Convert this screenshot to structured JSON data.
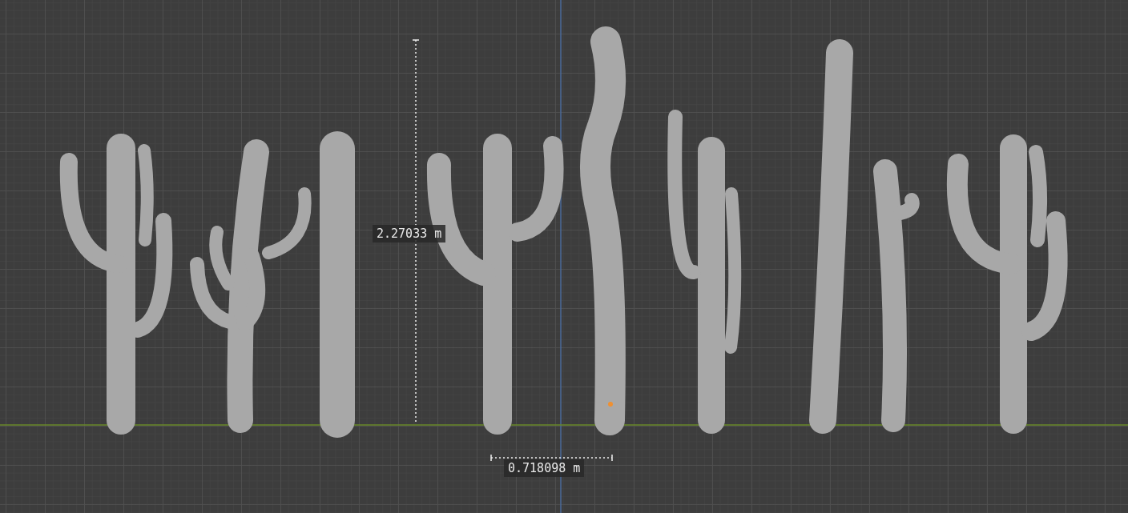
{
  "viewport": {
    "measurements": [
      {
        "kind": "vertical",
        "label": "2.27033 m"
      },
      {
        "kind": "horizontal",
        "label": "0.718098 m"
      }
    ]
  }
}
